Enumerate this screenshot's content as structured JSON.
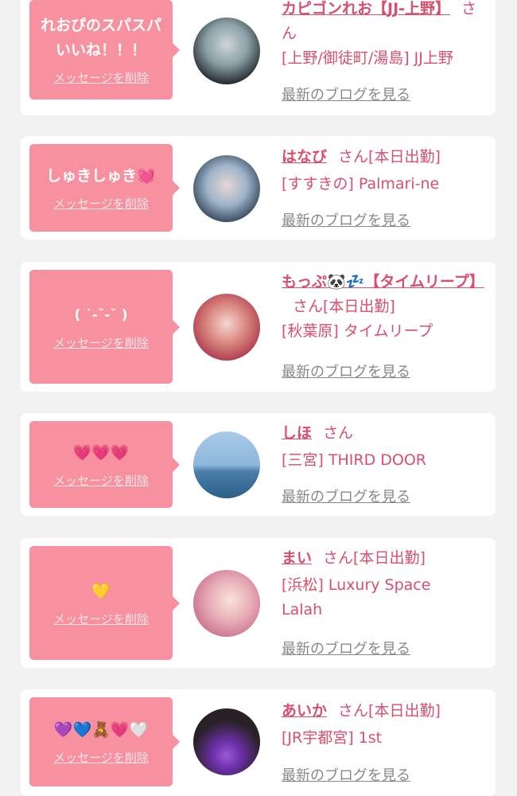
{
  "common": {
    "delete_label": "メッセージを削除",
    "san": "さん",
    "blog_link": "最新のブログを見る"
  },
  "cards": [
    {
      "message": "れおぴのスパスパいいね！！！",
      "name": "カピゴンれお【JJ-上野】",
      "status": "",
      "shop": "[上野/御徒町/湯島] JJ上野"
    },
    {
      "message": "しゅきしゅき💓",
      "name": "はなび",
      "status": "[本日出勤]",
      "shop": "[すすきの] Palmari-ne"
    },
    {
      "message": "( ˙-˘-˘ )",
      "name": "もっぷ🐼💤【タイムリープ】",
      "status": "[本日出勤]",
      "shop": "[秋葉原] タイムリープ"
    },
    {
      "message": "💗💗💗",
      "name": "しほ",
      "status": "",
      "shop": "[三宮] THIRD DOOR"
    },
    {
      "message": "💛",
      "name": "まい",
      "status": "[本日出勤]",
      "shop": "[浜松] Luxury Space Lalah"
    },
    {
      "message": "💜💙🧸💗🤍",
      "name": "あいか",
      "status": "[本日出勤]",
      "shop": "[JR宇都宮] 1st"
    }
  ],
  "colors": {
    "bubble": "#f7909f",
    "accent": "#d94f6d",
    "link_gray": "#888888"
  }
}
